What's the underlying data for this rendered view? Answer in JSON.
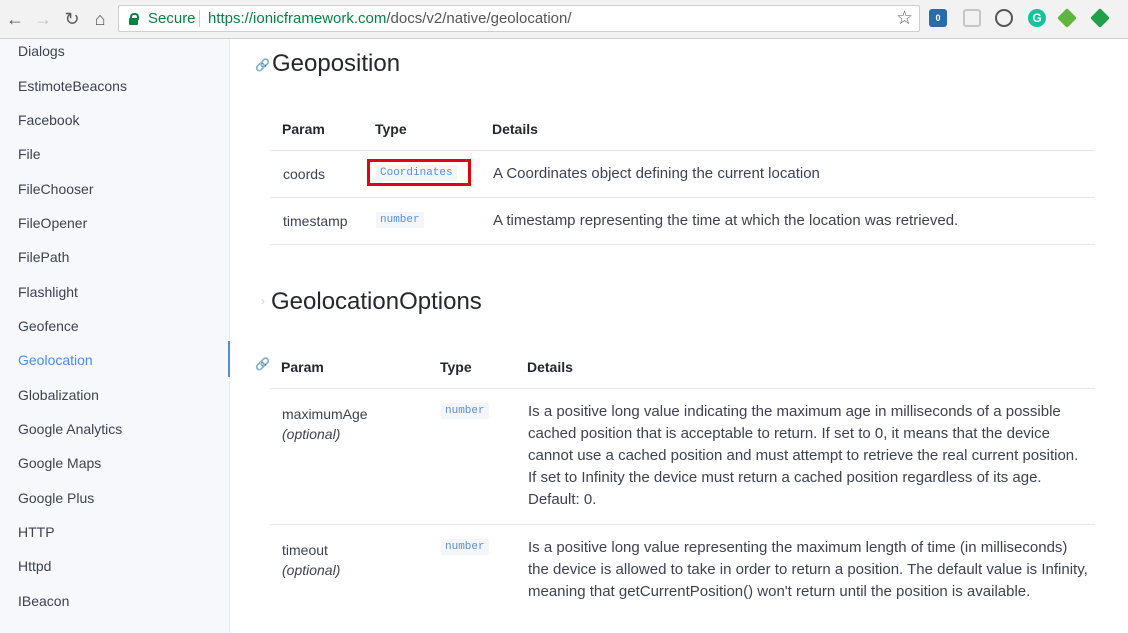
{
  "browser": {
    "secure_label": "Secure",
    "url_host": "https://ionicframework.com",
    "url_path": "/docs/v2/native/geolocation/"
  },
  "sidebar": {
    "items": [
      {
        "label": "Dialogs"
      },
      {
        "label": "EstimoteBeacons"
      },
      {
        "label": "Facebook"
      },
      {
        "label": "File"
      },
      {
        "label": "FileChooser"
      },
      {
        "label": "FileOpener"
      },
      {
        "label": "FilePath"
      },
      {
        "label": "Flashlight"
      },
      {
        "label": "Geofence"
      },
      {
        "label": "Geolocation",
        "active": true
      },
      {
        "label": "Globalization"
      },
      {
        "label": "Google Analytics"
      },
      {
        "label": "Google Maps"
      },
      {
        "label": "Google Plus"
      },
      {
        "label": "HTTP"
      },
      {
        "label": "Httpd"
      },
      {
        "label": "IBeacon"
      }
    ]
  },
  "geoposition": {
    "title": "Geoposition",
    "headers": {
      "param": "Param",
      "type": "Type",
      "details": "Details"
    },
    "rows": [
      {
        "param": "coords",
        "type": "Coordinates",
        "details": "A Coordinates object defining the current location"
      },
      {
        "param": "timestamp",
        "type": "number",
        "details": "A timestamp representing the time at which the location was retrieved."
      }
    ]
  },
  "options": {
    "title": "GeolocationOptions",
    "headers": {
      "param": "Param",
      "type": "Type",
      "details": "Details"
    },
    "rows": [
      {
        "param": "maximumAge",
        "optional": "(optional)",
        "type": "number",
        "details": "Is a positive long value indicating the maximum age in milliseconds of a possible cached position that is acceptable to return. If set to 0, it means that the device cannot use a cached position and must attempt to retrieve the real current position. If set to Infinity the device must return a cached position regardless of its age. Default: 0."
      },
      {
        "param": "timeout",
        "optional": "(optional)",
        "type": "number",
        "details": "Is a positive long value representing the maximum length of time (in milliseconds) the device is allowed to take in order to return a position. The default value is Infinity, meaning that getCurrentPosition() won't return until the position is available."
      }
    ]
  },
  "colors": {
    "accent": "#4a8bf0",
    "secure_green": "#0b8043",
    "highlight": "#e3000f"
  }
}
